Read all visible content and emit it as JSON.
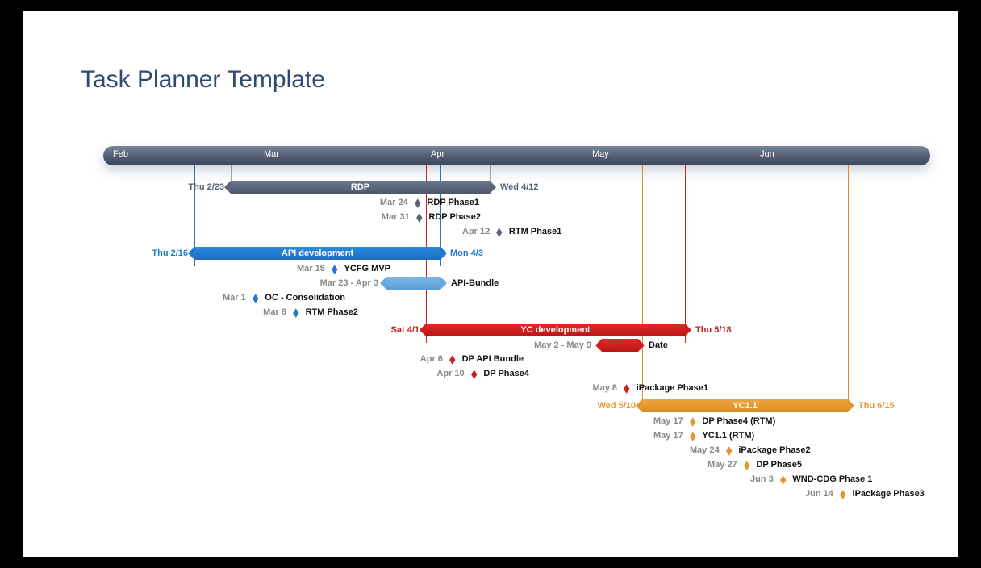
{
  "title": "Task Planner Template",
  "chart_data": {
    "type": "gantt",
    "time_axis": {
      "start": "Feb 1",
      "months": [
        "Feb",
        "Mar",
        "Apr",
        "May",
        "Jun"
      ],
      "end": "mid-Jun"
    },
    "tracks": [
      {
        "id": "rdp",
        "label": "RDP",
        "color": "gray",
        "start": "Thu 2/23",
        "end": "Wed 4/12",
        "milestones": [
          {
            "date": "Mar 24",
            "label": "RDP Phase1"
          },
          {
            "date": "Mar 31",
            "label": "RDP Phase2"
          },
          {
            "date": "Apr 12",
            "label": "RTM Phase1"
          }
        ]
      },
      {
        "id": "api",
        "label": "API development",
        "color": "blue",
        "start": "Thu 2/16",
        "end": "Mon 4/3",
        "subbars": [
          {
            "label": "API-Bundle",
            "start": "Mar 23",
            "end": "Apr 3",
            "color": "lightblue",
            "range_text": "Mar 23 - Apr 3"
          }
        ],
        "milestones": [
          {
            "date": "Mar 15",
            "label": "YCFG MVP"
          },
          {
            "date": "Mar 1",
            "label": "OC - Consolidation"
          },
          {
            "date": "Mar 8",
            "label": "RTM Phase2"
          }
        ]
      },
      {
        "id": "yc",
        "label": "YC development",
        "color": "red",
        "start": "Sat 4/1",
        "end": "Thu 5/18",
        "subbars": [
          {
            "label": "Date",
            "start": "May 2",
            "end": "May 9",
            "color": "red",
            "range_text": "May 2 - May 9"
          }
        ],
        "milestones": [
          {
            "date": "Apr 6",
            "label": "DP API Bundle"
          },
          {
            "date": "Apr 10",
            "label": "DP Phase4"
          },
          {
            "date": "May 8",
            "label": "iPackage Phase1"
          }
        ]
      },
      {
        "id": "yc11",
        "label": "YC1.1",
        "color": "orange",
        "start": "Wed 5/10",
        "end": "Thu 6/15",
        "milestones": [
          {
            "date": "May 17",
            "label": "DP Phase4 (RTM)"
          },
          {
            "date": "May 17",
            "label": "YC1.1 (RTM)"
          },
          {
            "date": "May 24",
            "label": "iPackage Phase2"
          },
          {
            "date": "May 27",
            "label": "DP Phase5"
          },
          {
            "date": "Jun 3",
            "label": "WND-CDG Phase 1"
          },
          {
            "date": "Jun 14",
            "label": "iPackage Phase3"
          }
        ]
      }
    ]
  }
}
